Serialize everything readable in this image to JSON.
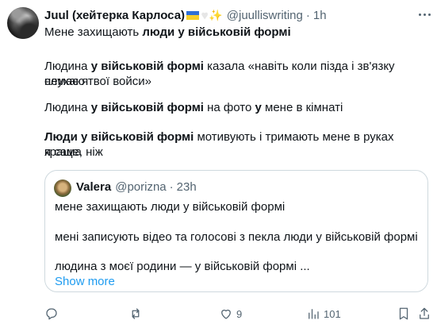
{
  "tweet": {
    "name": "Juul (хейтерка Карлоса)",
    "handle": "@juulliswriting",
    "time": "1h",
    "lines": [
      [
        {
          "t": "Мене захищають ",
          "b": false
        },
        {
          "t": "люди у військовій формі",
          "b": true
        }
      ],
      [
        {
          "t": "Людина ",
          "b": false
        },
        {
          "t": "у військовій формі",
          "b": true
        },
        {
          "t": " казала «навіть коли пізда і зв'язку немає я",
          "b": false
        }
      ],
      [
        {
          "t": "слухаю твої войси»",
          "b": false
        }
      ],
      [
        {
          "t": "Людина ",
          "b": false
        },
        {
          "t": "у військовій формі",
          "b": true
        },
        {
          "t": " на фото ",
          "b": false
        },
        {
          "t": "у",
          "b": true
        },
        {
          "t": " мене в кімнаті",
          "b": false
        }
      ],
      [
        {
          "t": "Люди у військовій формі",
          "b": true
        },
        {
          "t": " мотивують і тримають мене в руках краще, ніж",
          "b": false
        }
      ],
      [
        {
          "t": "я сама",
          "b": false
        }
      ]
    ]
  },
  "quote": {
    "name": "Valera",
    "handle": "@porizna",
    "time": "23h",
    "lines": [
      "мене захищають люди у військовій формі",
      "мені записують відео та голосові з пекла люди у військовій формі",
      "людина з моєї родини — у військовій формі ..."
    ],
    "show_more": "Show more"
  },
  "actions": {
    "replies": "",
    "retweets": "",
    "likes": "9",
    "views": "101"
  },
  "colors": {
    "text": "#0f1419",
    "secondary": "#536471",
    "link": "#1d9bf0",
    "border": "#cfd9de"
  }
}
